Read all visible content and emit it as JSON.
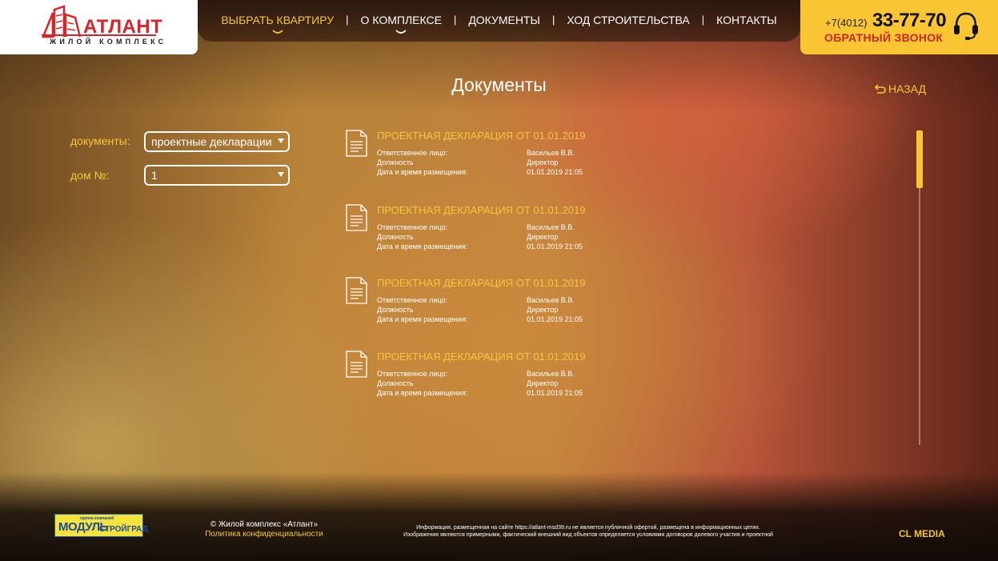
{
  "logo": {
    "name": "АТЛАНТ",
    "subtitle": "ЖИЛОЙ КОМПЛЕКС"
  },
  "nav": {
    "items": [
      {
        "label": "ВЫБРАТЬ КВАРТИРУ"
      },
      {
        "label": "О КОМПЛЕКСЕ"
      },
      {
        "label": "ДОКУМЕНТЫ"
      },
      {
        "label": "ХОД СТРОИТЕЛЬСТВА"
      },
      {
        "label": "КОНТАКТЫ"
      }
    ],
    "separator": "|"
  },
  "phone": {
    "prefix": "+7(4012)",
    "number": "33-77-70",
    "callback": "ОБРАТНЫЙ ЗВОНОК"
  },
  "page": {
    "title": "Документы",
    "back": "НАЗАД"
  },
  "filters": {
    "documents_label": "документы:",
    "documents_value": "проектные декларации",
    "house_label": "дом №:",
    "house_value": "1"
  },
  "documents": [
    {
      "title": "ПРОЕКТНАЯ ДЕКЛАРАЦИЯ ОТ 01.01.2019",
      "rows": [
        {
          "label": "Ответственное лицо:",
          "value": "Васильев В.В."
        },
        {
          "label": "Должность",
          "value": "Директор"
        },
        {
          "label": "Дата и время размещения:",
          "value": "01.01.2019 21:05"
        }
      ]
    },
    {
      "title": "ПРОЕКТНАЯ ДЕКЛАРАЦИЯ ОТ 01.01.2019",
      "rows": [
        {
          "label": "Ответственное лицо:",
          "value": "Васильев В.В."
        },
        {
          "label": "Должность",
          "value": "Директор"
        },
        {
          "label": "Дата и время размещения:",
          "value": "01.01.2019 21:05"
        }
      ]
    },
    {
      "title": "ПРОЕКТНАЯ ДЕКЛАРАЦИЯ ОТ 01.01.2019",
      "rows": [
        {
          "label": "Ответственное лицо:",
          "value": "Васильев В.В."
        },
        {
          "label": "Должность",
          "value": "Директор"
        },
        {
          "label": "Дата и время размещения:",
          "value": "01.01.2019 21:05"
        }
      ]
    },
    {
      "title": "ПРОЕКТНАЯ ДЕКЛАРАЦИЯ ОТ 01.01.2019",
      "rows": [
        {
          "label": "Ответственное лицо:",
          "value": "Васильев В.В."
        },
        {
          "label": "Должность",
          "value": "Директор"
        },
        {
          "label": "Дата и время размещения:",
          "value": "01.01.2019 21:05"
        }
      ]
    }
  ],
  "footer": {
    "partner_small": "группа компаний",
    "partner_big1": "МОДУЛЬ",
    "partner_big2": "СТРОЙГРАД",
    "copyright": "© Жилой комплекс «Атлант»",
    "privacy": "Политика конфиденциальности",
    "disclaimer_1": "Информация, размещенная на сайте https://atlant-msd39.ru не является публичной офертой, размещена в информационных целях.",
    "disclaimer_2": "Изображения являются примерными, фактический внешний вид объектов определяется условиями договоров долевого участия и проектной",
    "studio": "CL MEDIA"
  },
  "colors": {
    "accent": "#f7c53a",
    "phone_bg": "#f9c532",
    "brand_red": "#d7262a"
  },
  "icons": [
    "building-logo-icon",
    "chevron-down-icon",
    "headset-icon",
    "back-arrow-icon",
    "document-icon",
    "dropdown-arrow-icon"
  ]
}
